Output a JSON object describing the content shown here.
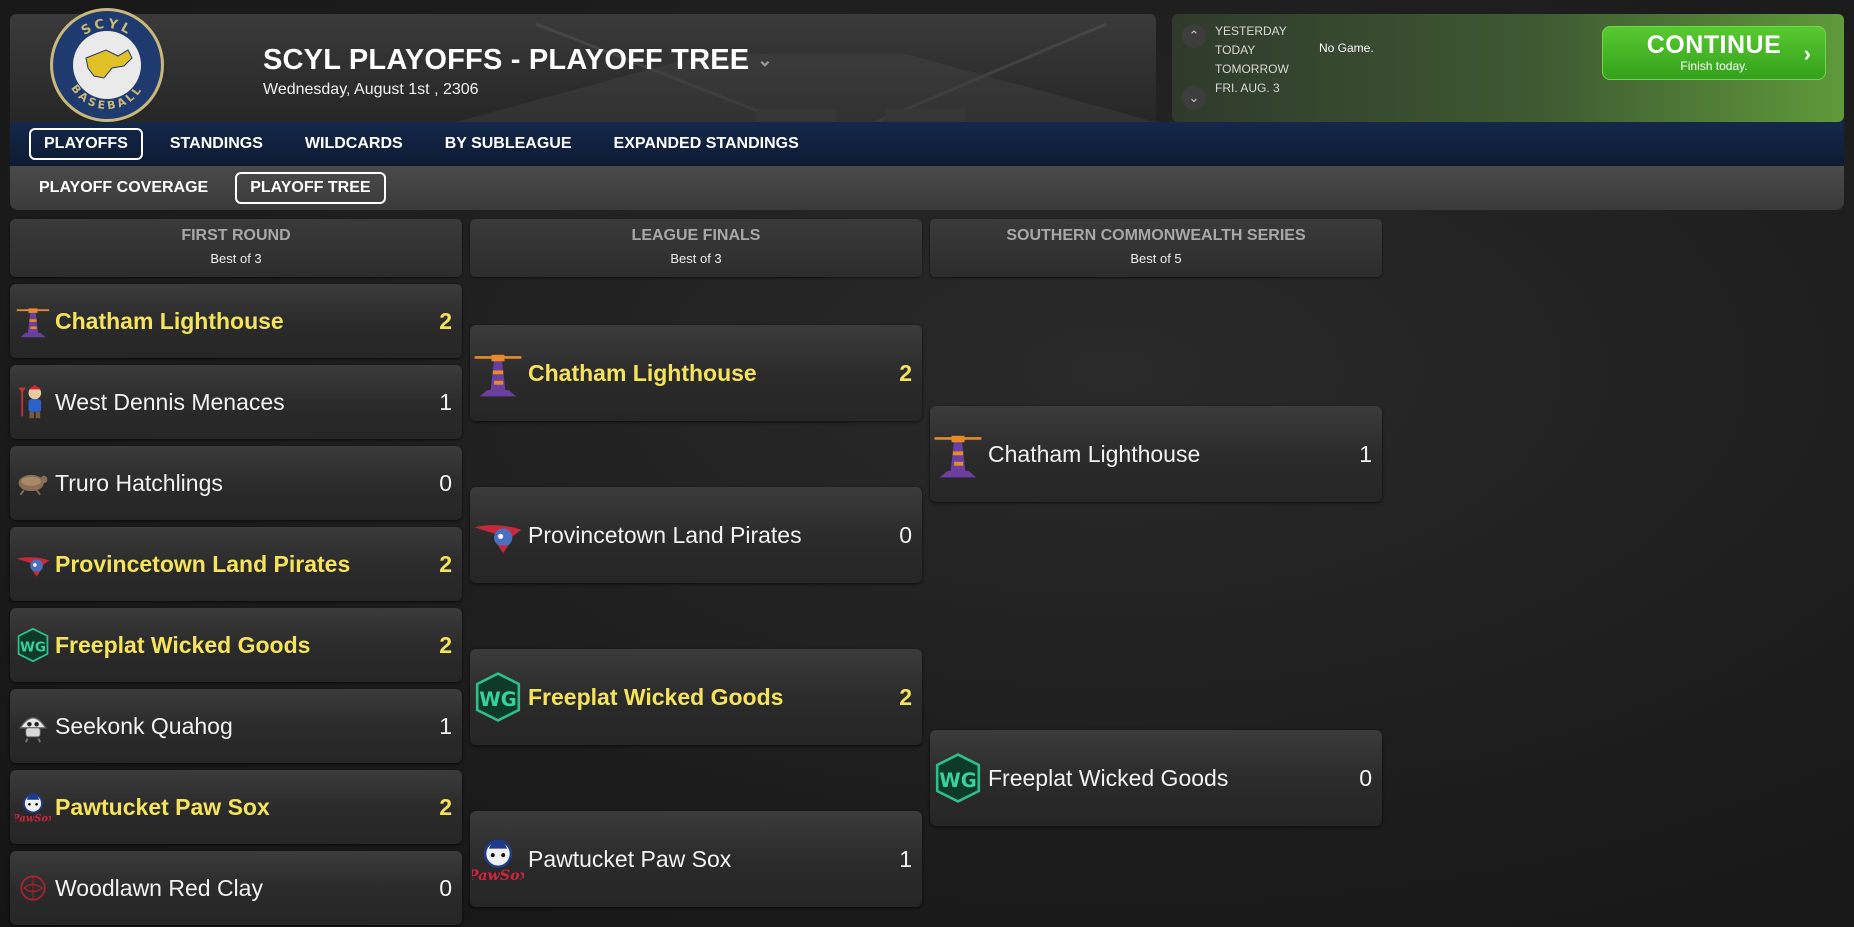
{
  "header": {
    "logo_text_top": "SCYL",
    "logo_text_bottom": "BASEBALL",
    "title": "SCYL PLAYOFFS - PLAYOFF TREE",
    "date": "Wednesday, August 1st , 2306"
  },
  "schedule": {
    "days": [
      "YESTERDAY",
      "TODAY",
      "TOMORROW",
      "FRI. AUG. 3"
    ],
    "today_status": "No Game.",
    "continue_label": "CONTINUE",
    "continue_sub": "Finish today."
  },
  "nav": {
    "main_tabs": [
      {
        "label": "PLAYOFFS",
        "active": true
      },
      {
        "label": "STANDINGS",
        "active": false
      },
      {
        "label": "WILDCARDS",
        "active": false
      },
      {
        "label": "BY SUBLEAGUE",
        "active": false
      },
      {
        "label": "EXPANDED STANDINGS",
        "active": false
      }
    ],
    "sub_tabs": [
      {
        "label": "PLAYOFF COVERAGE",
        "active": false
      },
      {
        "label": "PLAYOFF TREE",
        "active": true
      }
    ]
  },
  "bracket": {
    "rounds": [
      {
        "title": "FIRST ROUND",
        "format": "Best of 3",
        "teams": [
          {
            "name": "Chatham Lighthouse",
            "score": "2",
            "winner": true,
            "logo": "lighthouse-logo"
          },
          {
            "name": "West Dennis Menaces",
            "score": "1",
            "winner": false,
            "logo": "menace-logo"
          },
          {
            "name": "Truro Hatchlings",
            "score": "0",
            "winner": false,
            "logo": "hatchling-logo"
          },
          {
            "name": "Provincetown Land Pirates",
            "score": "2",
            "winner": true,
            "logo": "pirate-logo"
          },
          {
            "name": "Freeplat Wicked Goods",
            "score": "2",
            "winner": true,
            "logo": "wg-logo"
          },
          {
            "name": "Seekonk Quahog",
            "score": "1",
            "winner": false,
            "logo": "quahog-logo"
          },
          {
            "name": "Pawtucket Paw Sox",
            "score": "2",
            "winner": true,
            "logo": "pawsox-logo"
          },
          {
            "name": "Woodlawn Red Clay",
            "score": "0",
            "winner": false,
            "logo": "redclay-logo"
          }
        ]
      },
      {
        "title": "LEAGUE FINALS",
        "format": "Best of 3",
        "teams": [
          {
            "name": "Chatham Lighthouse",
            "score": "2",
            "winner": true,
            "logo": "lighthouse-logo"
          },
          {
            "name": "Provincetown Land Pirates",
            "score": "0",
            "winner": false,
            "logo": "pirate-logo"
          },
          {
            "name": "Freeplat Wicked Goods",
            "score": "2",
            "winner": true,
            "logo": "wg-logo"
          },
          {
            "name": "Pawtucket Paw Sox",
            "score": "1",
            "winner": false,
            "logo": "pawsox-logo"
          }
        ]
      },
      {
        "title": "SOUTHERN COMMONWEALTH SERIES",
        "format": "Best of 5",
        "teams": [
          {
            "name": "Chatham Lighthouse",
            "score": "1",
            "winner": false,
            "logo": "lighthouse-logo"
          },
          {
            "name": "Freeplat Wicked Goods",
            "score": "0",
            "winner": false,
            "logo": "wg-logo"
          }
        ]
      }
    ]
  },
  "colors": {
    "winner_text": "#f5e35c",
    "continue_green": "#3fb025",
    "nav_blue": "#0d1b33"
  }
}
